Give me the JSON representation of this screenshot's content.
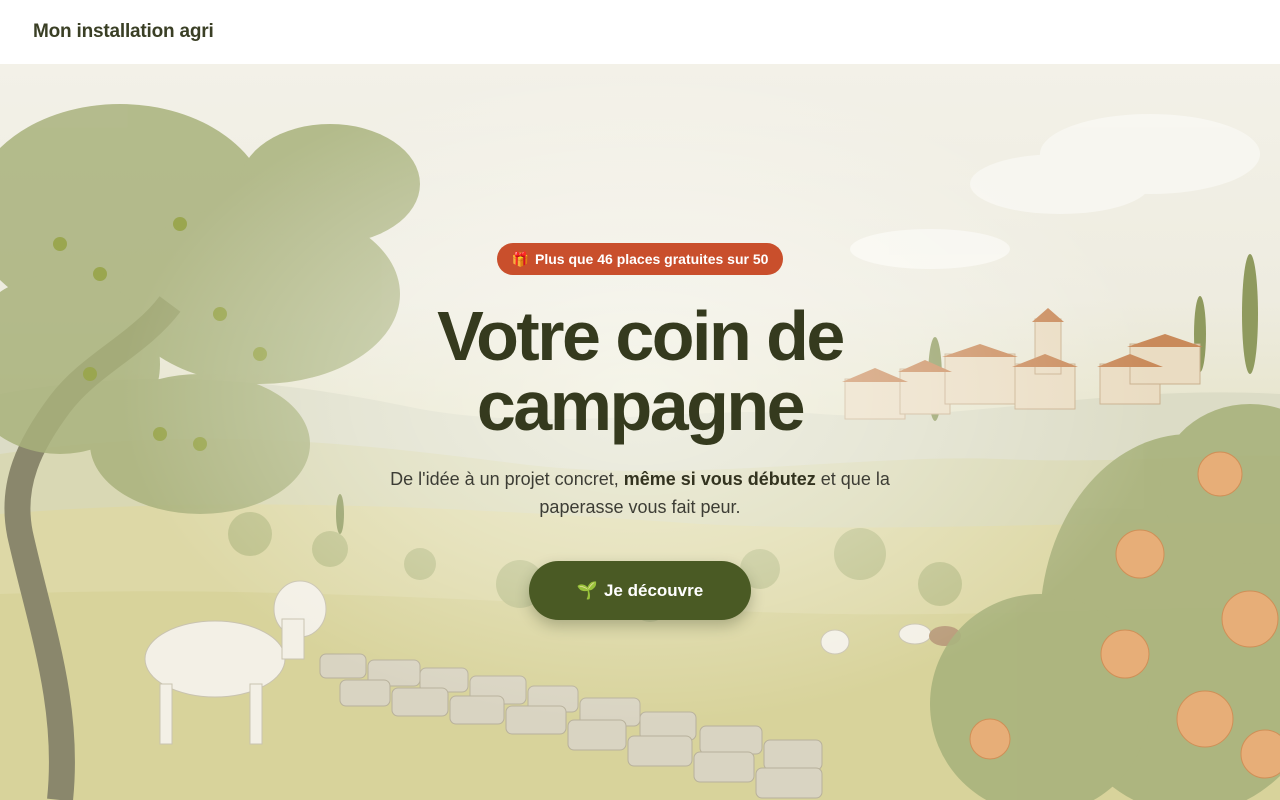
{
  "header": {
    "brand": "Mon installation agri"
  },
  "hero": {
    "badge": {
      "icon": "🎁",
      "icon_name": "gift-icon",
      "text": "Plus que 46 places gratuites sur 50"
    },
    "headline": "Votre coin de campagne",
    "subtitle": {
      "part1": "De l'idée à un projet concret, ",
      "emphasis": "même si vous débutez",
      "part2": " et que la paperasse vous fait peur."
    },
    "cta": {
      "icon": "🌱",
      "icon_name": "seedling-icon",
      "label": "Je découvre"
    }
  },
  "colors": {
    "brand_text": "#3a3f25",
    "badge_bg": "#c94f2c",
    "headline": "#353a1e",
    "cta_bg": "#4a5a24"
  }
}
